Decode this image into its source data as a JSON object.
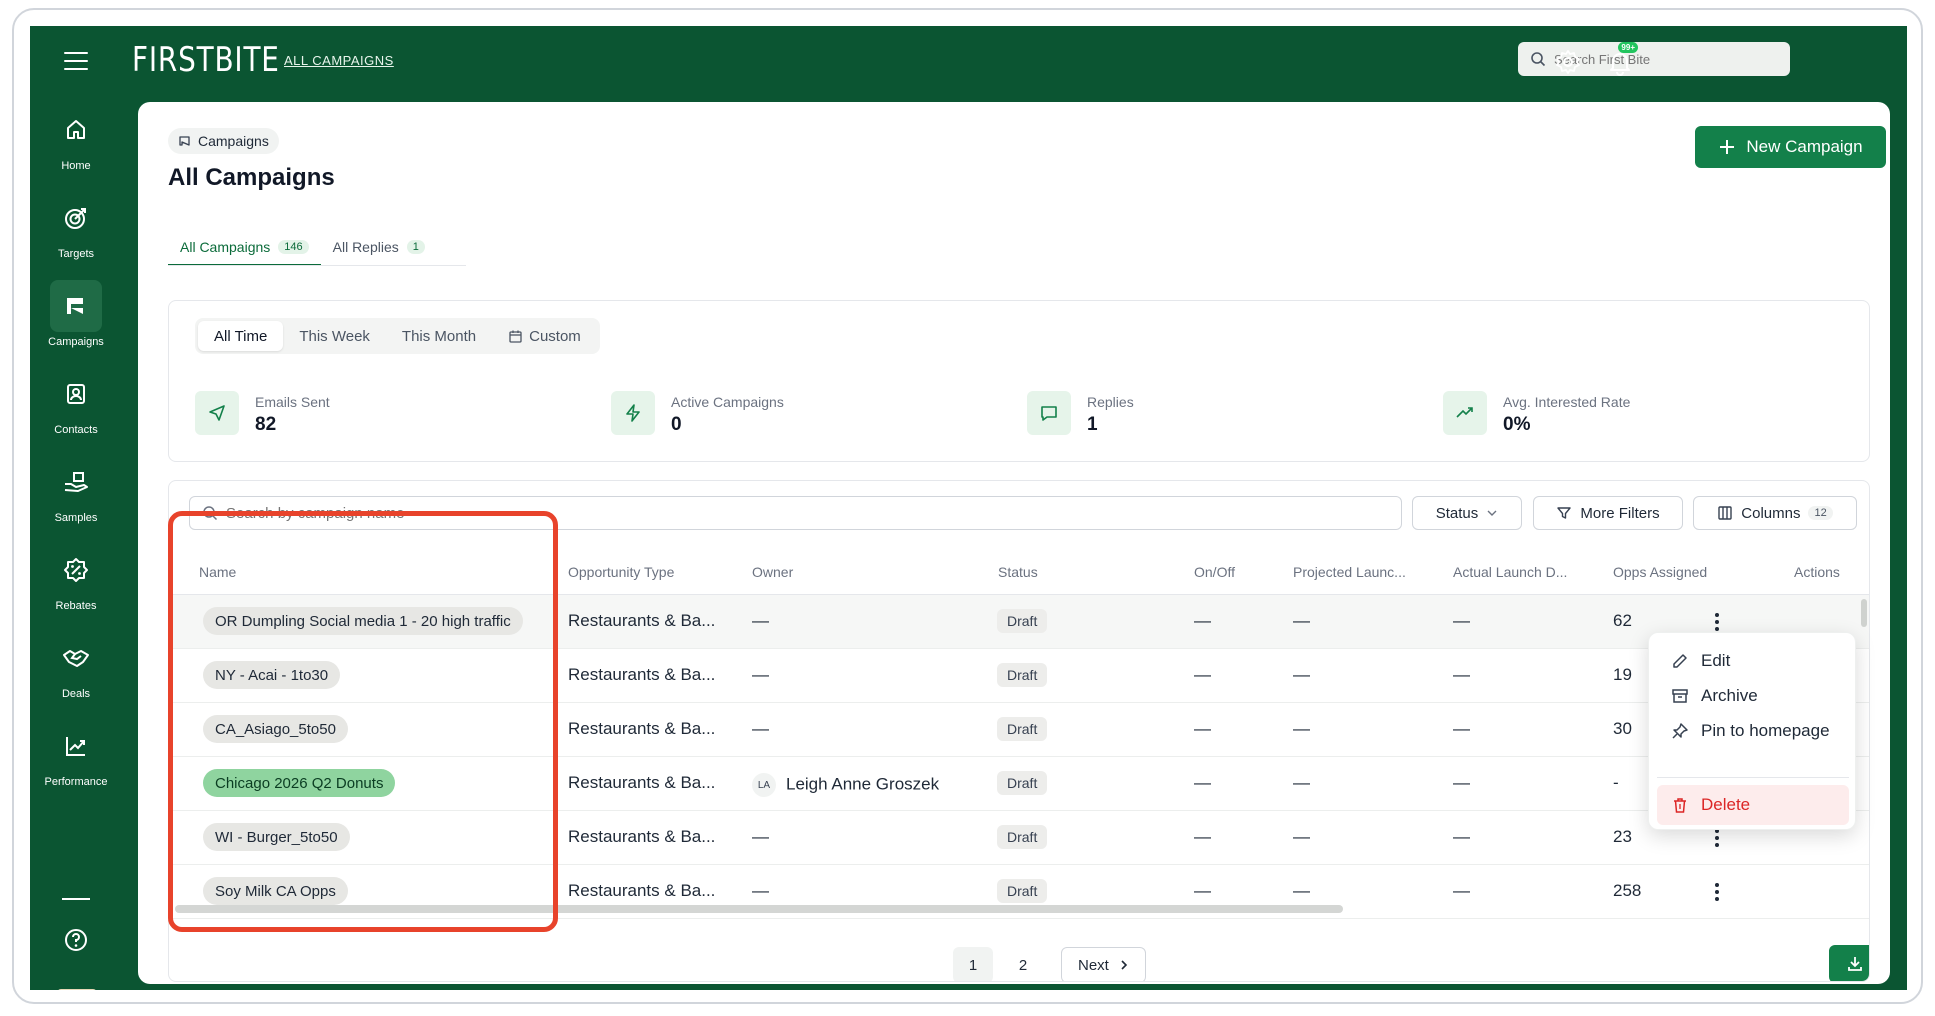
{
  "header": {
    "logo": "FIRSTBITE",
    "breadcrumb_link": "ALL CAMPAIGNS",
    "search_placeholder": "Search First Bite",
    "notification_badge": "99+"
  },
  "sidebar": {
    "items": [
      {
        "label": "Home",
        "icon": "home-icon"
      },
      {
        "label": "Targets",
        "icon": "target-icon"
      },
      {
        "label": "Campaigns",
        "icon": "megaphone-icon"
      },
      {
        "label": "Contacts",
        "icon": "contact-card-icon"
      },
      {
        "label": "Samples",
        "icon": "hand-box-icon"
      },
      {
        "label": "Rebates",
        "icon": "percent-badge-icon"
      },
      {
        "label": "Deals",
        "icon": "handshake-icon"
      },
      {
        "label": "Performance",
        "icon": "chart-up-icon"
      }
    ]
  },
  "page": {
    "crumb_chip": "Campaigns",
    "title": "All Campaigns",
    "new_button": "New Campaign",
    "tabs": [
      {
        "label": "All Campaigns",
        "count": "146"
      },
      {
        "label": "All Replies",
        "count": "1"
      }
    ],
    "ranges": [
      "All Time",
      "This Week",
      "This Month",
      "Custom"
    ],
    "stats": [
      {
        "label": "Emails Sent",
        "value": "82"
      },
      {
        "label": "Active Campaigns",
        "value": "0"
      },
      {
        "label": "Replies",
        "value": "1"
      },
      {
        "label": "Avg. Interested Rate",
        "value": "0%"
      }
    ]
  },
  "table": {
    "search_placeholder": "Search by campaign name",
    "status_filter": "Status",
    "more_filters": "More Filters",
    "columns_button": "Columns",
    "columns_count": "12",
    "headers": [
      "Name",
      "Opportunity Type",
      "Owner",
      "Status",
      "On/Off",
      "Projected Launc...",
      "Actual Launch D...",
      "Opps Assigned",
      "Actions"
    ],
    "rows": [
      {
        "name": "OR Dumpling Social media 1 - 20 high traffic",
        "type": "Restaurants & Ba...",
        "owner": "—",
        "owner_initials": "",
        "status": "Draft",
        "onoff": "—",
        "projected": "—",
        "actual": "—",
        "opps": "62"
      },
      {
        "name": "NY - Acai - 1to30",
        "type": "Restaurants & Ba...",
        "owner": "—",
        "owner_initials": "",
        "status": "Draft",
        "onoff": "—",
        "projected": "—",
        "actual": "—",
        "opps": "19"
      },
      {
        "name": "CA_Asiago_5to50",
        "type": "Restaurants & Ba...",
        "owner": "—",
        "owner_initials": "",
        "status": "Draft",
        "onoff": "—",
        "projected": "—",
        "actual": "—",
        "opps": "30"
      },
      {
        "name": "Chicago 2026 Q2 Donuts",
        "type": "Restaurants & Ba...",
        "owner": "Leigh Anne Groszek",
        "owner_initials": "LA",
        "status": "Draft",
        "onoff": "—",
        "projected": "—",
        "actual": "—",
        "opps": "-"
      },
      {
        "name": "WI - Burger_5to50",
        "type": "Restaurants & Ba...",
        "owner": "—",
        "owner_initials": "",
        "status": "Draft",
        "onoff": "—",
        "projected": "—",
        "actual": "—",
        "opps": "23"
      },
      {
        "name": "Soy Milk CA Opps",
        "type": "Restaurants & Ba...",
        "owner": "—",
        "owner_initials": "",
        "status": "Draft",
        "onoff": "—",
        "projected": "—",
        "actual": "—",
        "opps": "258"
      }
    ],
    "pages": [
      "1",
      "2"
    ],
    "next_label": "Next"
  },
  "menu": {
    "items": [
      "Edit",
      "Archive",
      "Pin to homepage",
      "Delete"
    ]
  },
  "colors": {
    "brand_green": "#0b5532",
    "accent_green": "#13804a",
    "highlight_red": "#e8432b",
    "danger": "#dc2626"
  }
}
